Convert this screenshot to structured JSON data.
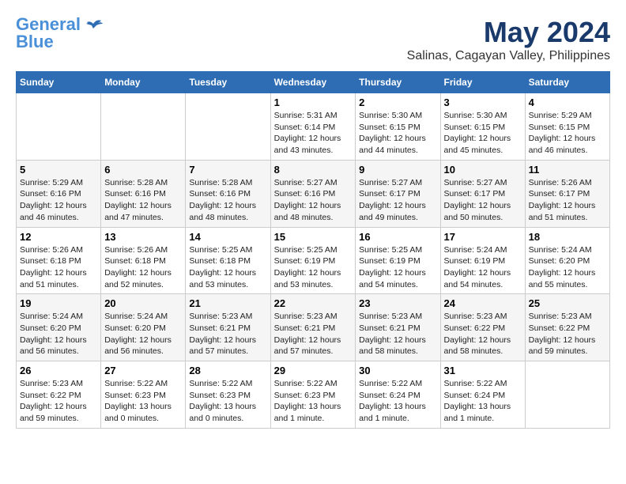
{
  "header": {
    "logo_line1": "General",
    "logo_line2": "Blue",
    "month": "May 2024",
    "location": "Salinas, Cagayan Valley, Philippines"
  },
  "days_of_week": [
    "Sunday",
    "Monday",
    "Tuesday",
    "Wednesday",
    "Thursday",
    "Friday",
    "Saturday"
  ],
  "weeks": [
    [
      {
        "day": "",
        "info": ""
      },
      {
        "day": "",
        "info": ""
      },
      {
        "day": "",
        "info": ""
      },
      {
        "day": "1",
        "info": "Sunrise: 5:31 AM\nSunset: 6:14 PM\nDaylight: 12 hours\nand 43 minutes."
      },
      {
        "day": "2",
        "info": "Sunrise: 5:30 AM\nSunset: 6:15 PM\nDaylight: 12 hours\nand 44 minutes."
      },
      {
        "day": "3",
        "info": "Sunrise: 5:30 AM\nSunset: 6:15 PM\nDaylight: 12 hours\nand 45 minutes."
      },
      {
        "day": "4",
        "info": "Sunrise: 5:29 AM\nSunset: 6:15 PM\nDaylight: 12 hours\nand 46 minutes."
      }
    ],
    [
      {
        "day": "5",
        "info": "Sunrise: 5:29 AM\nSunset: 6:16 PM\nDaylight: 12 hours\nand 46 minutes."
      },
      {
        "day": "6",
        "info": "Sunrise: 5:28 AM\nSunset: 6:16 PM\nDaylight: 12 hours\nand 47 minutes."
      },
      {
        "day": "7",
        "info": "Sunrise: 5:28 AM\nSunset: 6:16 PM\nDaylight: 12 hours\nand 48 minutes."
      },
      {
        "day": "8",
        "info": "Sunrise: 5:27 AM\nSunset: 6:16 PM\nDaylight: 12 hours\nand 48 minutes."
      },
      {
        "day": "9",
        "info": "Sunrise: 5:27 AM\nSunset: 6:17 PM\nDaylight: 12 hours\nand 49 minutes."
      },
      {
        "day": "10",
        "info": "Sunrise: 5:27 AM\nSunset: 6:17 PM\nDaylight: 12 hours\nand 50 minutes."
      },
      {
        "day": "11",
        "info": "Sunrise: 5:26 AM\nSunset: 6:17 PM\nDaylight: 12 hours\nand 51 minutes."
      }
    ],
    [
      {
        "day": "12",
        "info": "Sunrise: 5:26 AM\nSunset: 6:18 PM\nDaylight: 12 hours\nand 51 minutes."
      },
      {
        "day": "13",
        "info": "Sunrise: 5:26 AM\nSunset: 6:18 PM\nDaylight: 12 hours\nand 52 minutes."
      },
      {
        "day": "14",
        "info": "Sunrise: 5:25 AM\nSunset: 6:18 PM\nDaylight: 12 hours\nand 53 minutes."
      },
      {
        "day": "15",
        "info": "Sunrise: 5:25 AM\nSunset: 6:19 PM\nDaylight: 12 hours\nand 53 minutes."
      },
      {
        "day": "16",
        "info": "Sunrise: 5:25 AM\nSunset: 6:19 PM\nDaylight: 12 hours\nand 54 minutes."
      },
      {
        "day": "17",
        "info": "Sunrise: 5:24 AM\nSunset: 6:19 PM\nDaylight: 12 hours\nand 54 minutes."
      },
      {
        "day": "18",
        "info": "Sunrise: 5:24 AM\nSunset: 6:20 PM\nDaylight: 12 hours\nand 55 minutes."
      }
    ],
    [
      {
        "day": "19",
        "info": "Sunrise: 5:24 AM\nSunset: 6:20 PM\nDaylight: 12 hours\nand 56 minutes."
      },
      {
        "day": "20",
        "info": "Sunrise: 5:24 AM\nSunset: 6:20 PM\nDaylight: 12 hours\nand 56 minutes."
      },
      {
        "day": "21",
        "info": "Sunrise: 5:23 AM\nSunset: 6:21 PM\nDaylight: 12 hours\nand 57 minutes."
      },
      {
        "day": "22",
        "info": "Sunrise: 5:23 AM\nSunset: 6:21 PM\nDaylight: 12 hours\nand 57 minutes."
      },
      {
        "day": "23",
        "info": "Sunrise: 5:23 AM\nSunset: 6:21 PM\nDaylight: 12 hours\nand 58 minutes."
      },
      {
        "day": "24",
        "info": "Sunrise: 5:23 AM\nSunset: 6:22 PM\nDaylight: 12 hours\nand 58 minutes."
      },
      {
        "day": "25",
        "info": "Sunrise: 5:23 AM\nSunset: 6:22 PM\nDaylight: 12 hours\nand 59 minutes."
      }
    ],
    [
      {
        "day": "26",
        "info": "Sunrise: 5:23 AM\nSunset: 6:22 PM\nDaylight: 12 hours\nand 59 minutes."
      },
      {
        "day": "27",
        "info": "Sunrise: 5:22 AM\nSunset: 6:23 PM\nDaylight: 13 hours\nand 0 minutes."
      },
      {
        "day": "28",
        "info": "Sunrise: 5:22 AM\nSunset: 6:23 PM\nDaylight: 13 hours\nand 0 minutes."
      },
      {
        "day": "29",
        "info": "Sunrise: 5:22 AM\nSunset: 6:23 PM\nDaylight: 13 hours\nand 1 minute."
      },
      {
        "day": "30",
        "info": "Sunrise: 5:22 AM\nSunset: 6:24 PM\nDaylight: 13 hours\nand 1 minute."
      },
      {
        "day": "31",
        "info": "Sunrise: 5:22 AM\nSunset: 6:24 PM\nDaylight: 13 hours\nand 1 minute."
      },
      {
        "day": "",
        "info": ""
      }
    ]
  ]
}
